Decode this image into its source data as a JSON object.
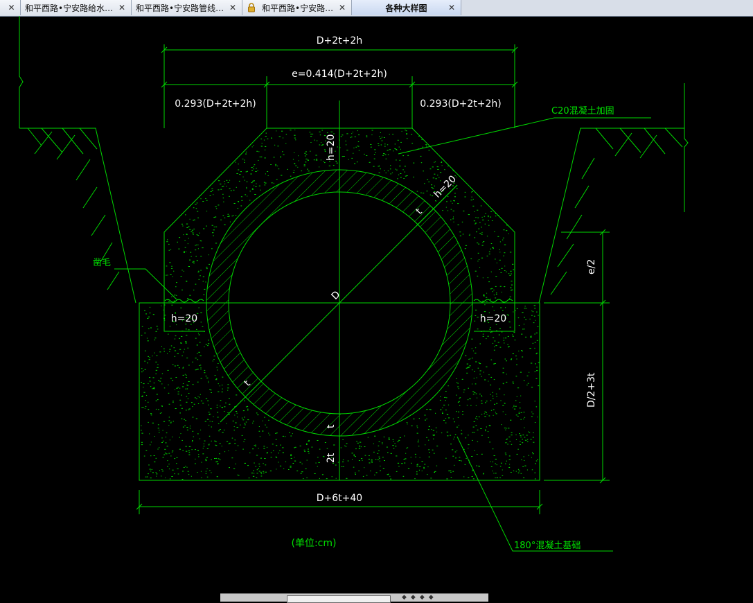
{
  "tabs": [
    {
      "label": "…",
      "has_close": true,
      "active": false
    },
    {
      "label": "和平西路•宁安路给水…",
      "has_close": true,
      "active": false
    },
    {
      "label": "和平西路•宁安路管线…",
      "has_close": true,
      "active": false
    },
    {
      "label": "和平西路•宁安路…",
      "has_close": true,
      "active": false,
      "locked": true
    },
    {
      "label": "各种大样图",
      "has_close": true,
      "active": true
    }
  ],
  "close_glyph": "✕",
  "drawing": {
    "dim_total_top": "D+2t+2h",
    "dim_e": "e=0.414(D+2t+2h)",
    "dim_left_top": "0.293(D+2t+2h)",
    "dim_right_top": "0.293(D+2t+2h)",
    "h_top": "h=20",
    "h_diag": "h=20",
    "t_diag": "t",
    "c20_label": "C20混凝土加固",
    "zaomao_label": "凿毛",
    "h_left": "h=20",
    "h_right": "h=20",
    "d_label": "D",
    "t_left": "t",
    "t_bottom": "t",
    "two_t": "2t",
    "e_half": "e/2",
    "d_half": "D/2+3t",
    "dim_bottom": "D+6t+40",
    "unit_label": "(单位:cm)",
    "base_label": "180°混凝土基础"
  },
  "colors": {
    "background": "#000000",
    "line_green": "#00d800",
    "text_white": "#ffffff",
    "text_green": "#00e000"
  }
}
